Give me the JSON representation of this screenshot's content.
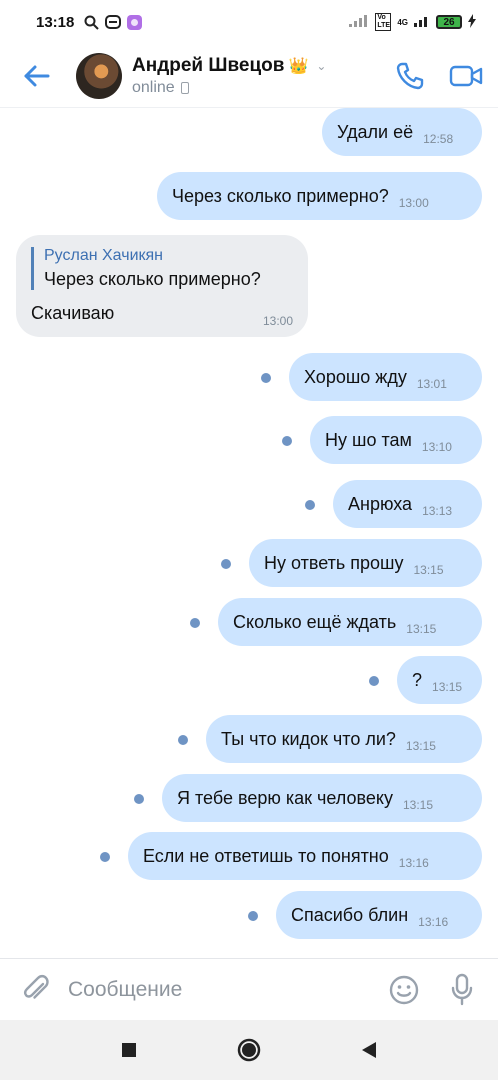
{
  "status_bar": {
    "time": "13:18",
    "battery": "26",
    "network": "4G",
    "volte": "Vo LTE",
    "icons": [
      "search-icon",
      "app-icon",
      "gallery-icon",
      "signal-icon",
      "wifi-icon",
      "charging-icon"
    ]
  },
  "header": {
    "contact_name": "Андрей Швецов",
    "badge": "👑",
    "status": "online",
    "accent": "#3f8ae0"
  },
  "incoming": {
    "reply_author": "Руслан Хачикян",
    "reply_text": "Через сколько примерно?",
    "text": "Скачиваю",
    "time": "13:00"
  },
  "outgoing": [
    {
      "text": "Удали её",
      "time": "12:58",
      "unread": false
    },
    {
      "text": "Через сколько примерно?",
      "time": "13:00",
      "unread": false
    },
    {
      "text": "Хорошо жду",
      "time": "13:01",
      "unread": true
    },
    {
      "text": "Ну шо там",
      "time": "13:10",
      "unread": true
    },
    {
      "text": "Анрюха",
      "time": "13:13",
      "unread": true
    },
    {
      "text": "Ну ответь прошу",
      "time": "13:15",
      "unread": true
    },
    {
      "text": "Сколько ещё ждать",
      "time": "13:15",
      "unread": true
    },
    {
      "text": "?",
      "time": "13:15",
      "unread": true
    },
    {
      "text": "Ты что кидок что ли?",
      "time": "13:15",
      "unread": true
    },
    {
      "text": "Я тебе верю как человеку",
      "time": "13:15",
      "unread": true
    },
    {
      "text": "Если не ответишь то понятно",
      "time": "13:16",
      "unread": true
    },
    {
      "text": "Спасибо блин",
      "time": "13:16",
      "unread": true
    }
  ],
  "composer": {
    "placeholder": "Сообщение"
  },
  "colors": {
    "outgoing_bubble": "#cce4ff",
    "incoming_bubble": "#ebedf0",
    "unread_dot": "#6f94c4"
  }
}
